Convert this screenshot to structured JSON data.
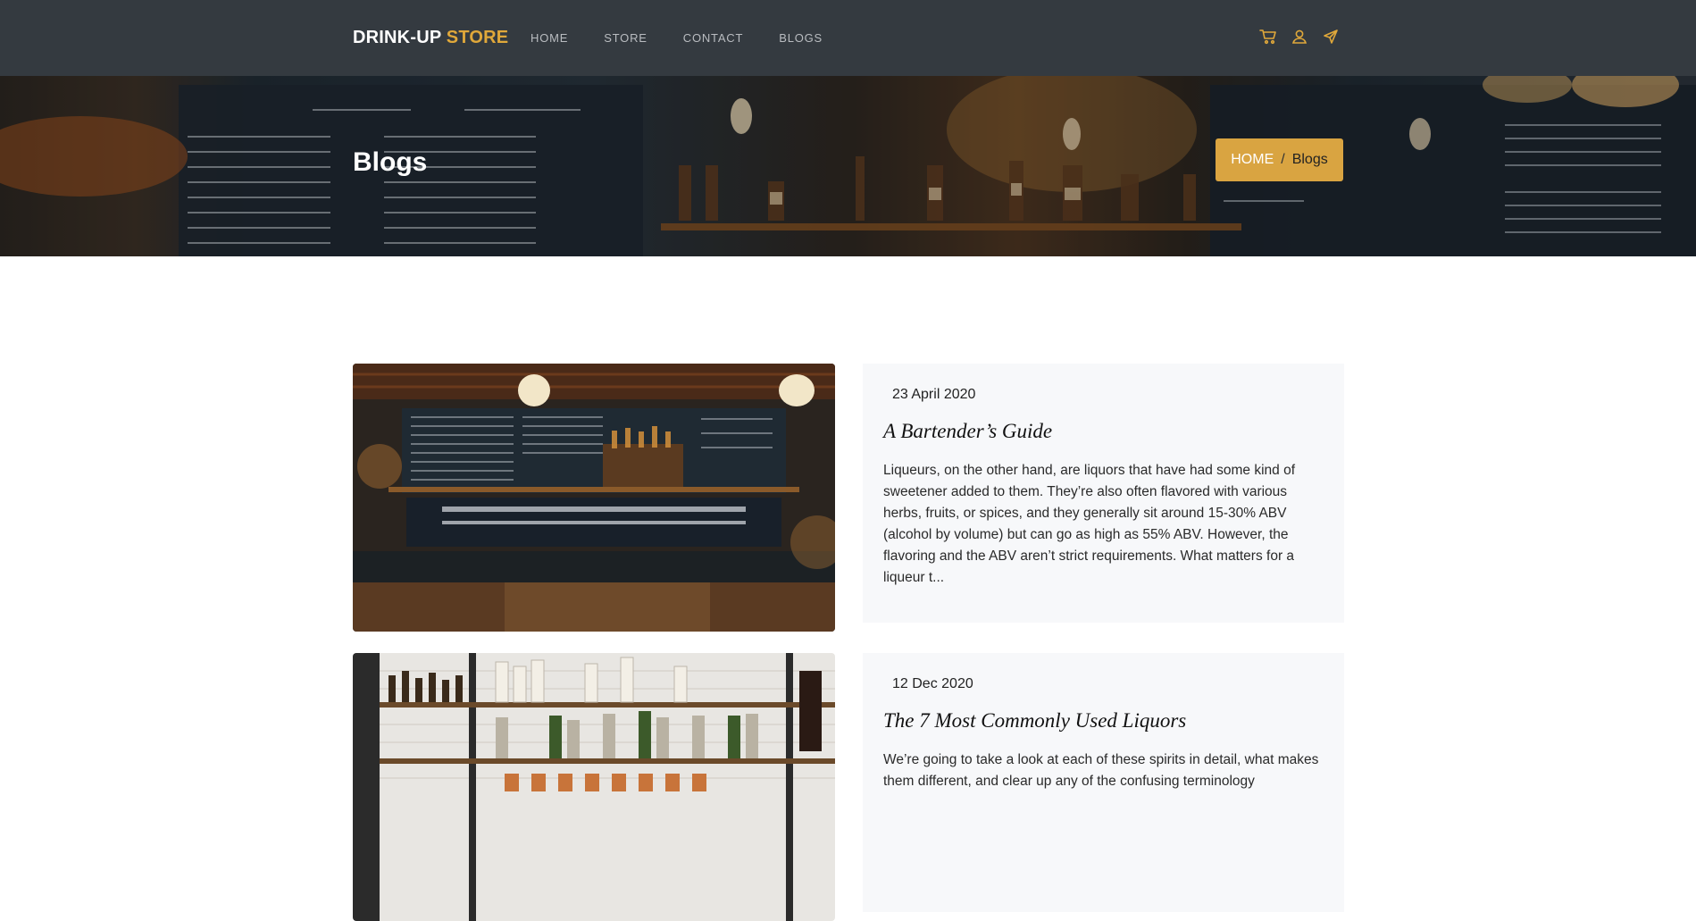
{
  "brand": {
    "name_main": "DRINK-UP",
    "name_accent": "STORE"
  },
  "nav": {
    "items": [
      "HOME",
      "STORE",
      "CONTACT",
      "BLOGS"
    ]
  },
  "header_icons": [
    "cart-icon",
    "user-icon",
    "send-icon"
  ],
  "colors": {
    "navbar": "#343a40",
    "accent": "#e0a83a",
    "breadcrumb_bg": "#d9a441",
    "card_bg": "#f7f8fa"
  },
  "hero": {
    "title": "Blogs",
    "breadcrumb": {
      "home": "HOME",
      "separator": "/",
      "current": "Blogs"
    }
  },
  "posts": [
    {
      "date": "23 April 2020",
      "title": "A Bartender’s Guide",
      "excerpt": "Liqueurs, on the other hand, are liquors that have had some kind of sweetener added to them. They’re also often flavored with various herbs, fruits, or spices, and they generally sit around 15-30% ABV (alcohol by volume) but can go as high as 55% ABV. However, the flavoring and the ABV aren’t strict requirements. What matters for a liqueur t..."
    },
    {
      "date": "12 Dec 2020",
      "title": "The 7 Most Commonly Used Liquors",
      "excerpt": "We’re going to take a look at each of these spirits in detail, what makes them different, and clear up any of the confusing terminology"
    }
  ]
}
